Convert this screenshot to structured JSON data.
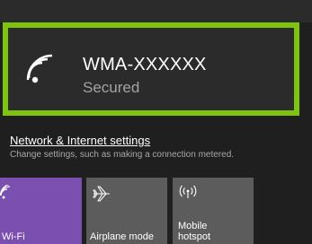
{
  "network": {
    "name": "WMA-XXXXXX",
    "status": "Secured",
    "icon": "wifi-icon"
  },
  "settings": {
    "link_label": "Network & Internet settings",
    "description": "Change settings, such as making a connection metered."
  },
  "quick_actions": [
    {
      "label": "Wi-Fi",
      "icon": "wifi-icon",
      "active": true
    },
    {
      "label": "Airplane mode",
      "icon": "airplane-icon",
      "active": false
    },
    {
      "label_line1": "Mobile",
      "label_line2": "hotspot",
      "icon": "mobile-hotspot-icon",
      "active": false
    }
  ],
  "colors": {
    "highlight_border": "#7ec40f",
    "active_tile": "#7a4fb0",
    "inactive_tile": "#5c5c5c",
    "background": "#1f1f1f"
  }
}
